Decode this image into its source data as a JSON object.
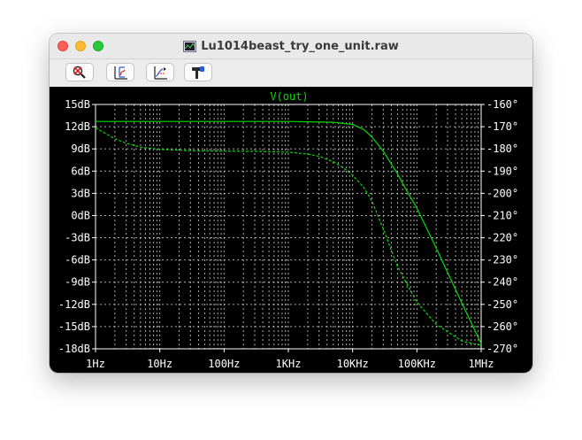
{
  "window": {
    "title": "Lu1014beast_try_one_unit.raw"
  },
  "toolbar": {
    "buttons": [
      {
        "icon": "zoom-cancel-icon"
      },
      {
        "icon": "autorange-icon"
      },
      {
        "icon": "pan-icon"
      },
      {
        "icon": "probe-hammer-icon"
      }
    ]
  },
  "chart_data": {
    "type": "line",
    "title": "V(out)",
    "x_scale": "log",
    "x_ticks": [
      "1Hz",
      "10Hz",
      "100Hz",
      "1KHz",
      "10KHz",
      "100KHz",
      "1MHz"
    ],
    "xlim_hz": [
      1,
      1000000
    ],
    "y_left_ticks": [
      "15dB",
      "12dB",
      "9dB",
      "6dB",
      "3dB",
      "0dB",
      "-3dB",
      "-6dB",
      "-9dB",
      "-12dB",
      "-15dB",
      "-18dB"
    ],
    "ylim_left_db": [
      -18,
      15
    ],
    "y_right_ticks": [
      "-160°",
      "-170°",
      "-180°",
      "-190°",
      "-200°",
      "-210°",
      "-220°",
      "-230°",
      "-240°",
      "-250°",
      "-260°",
      "-270°"
    ],
    "ylim_right_deg": [
      -270,
      -160
    ],
    "grid": true,
    "colors": {
      "background": "#000000",
      "trace": "#00dd00",
      "axes": "#ffffff",
      "title": "#00dd00",
      "grid": "#c8c8c8"
    },
    "series": [
      {
        "style": "solid",
        "axis": "left",
        "x": [
          1,
          10,
          100,
          1000,
          5000,
          10000,
          15000,
          20000,
          30000,
          50000,
          70000,
          100000,
          200000,
          500000,
          1000000
        ],
        "y": [
          12.7,
          12.7,
          12.7,
          12.7,
          12.6,
          12.3,
          11.6,
          10.6,
          8.7,
          5.6,
          3.3,
          1.0,
          -4.4,
          -11.8,
          -17.3
        ]
      },
      {
        "style": "dashed",
        "axis": "right",
        "x": [
          1,
          2,
          3,
          5,
          10,
          30,
          100,
          300,
          1000,
          2000,
          3000,
          5000,
          7000,
          10000,
          15000,
          20000,
          30000,
          50000,
          100000,
          200000,
          500000,
          1000000
        ],
        "y": [
          -170.5,
          -175.5,
          -177.5,
          -179.2,
          -180.2,
          -180.8,
          -181.0,
          -181.1,
          -181.5,
          -182.3,
          -183.3,
          -185.8,
          -188.3,
          -191.8,
          -197.5,
          -203.5,
          -216.0,
          -233.0,
          -249.0,
          -259.0,
          -266.5,
          -268.5
        ]
      }
    ]
  }
}
